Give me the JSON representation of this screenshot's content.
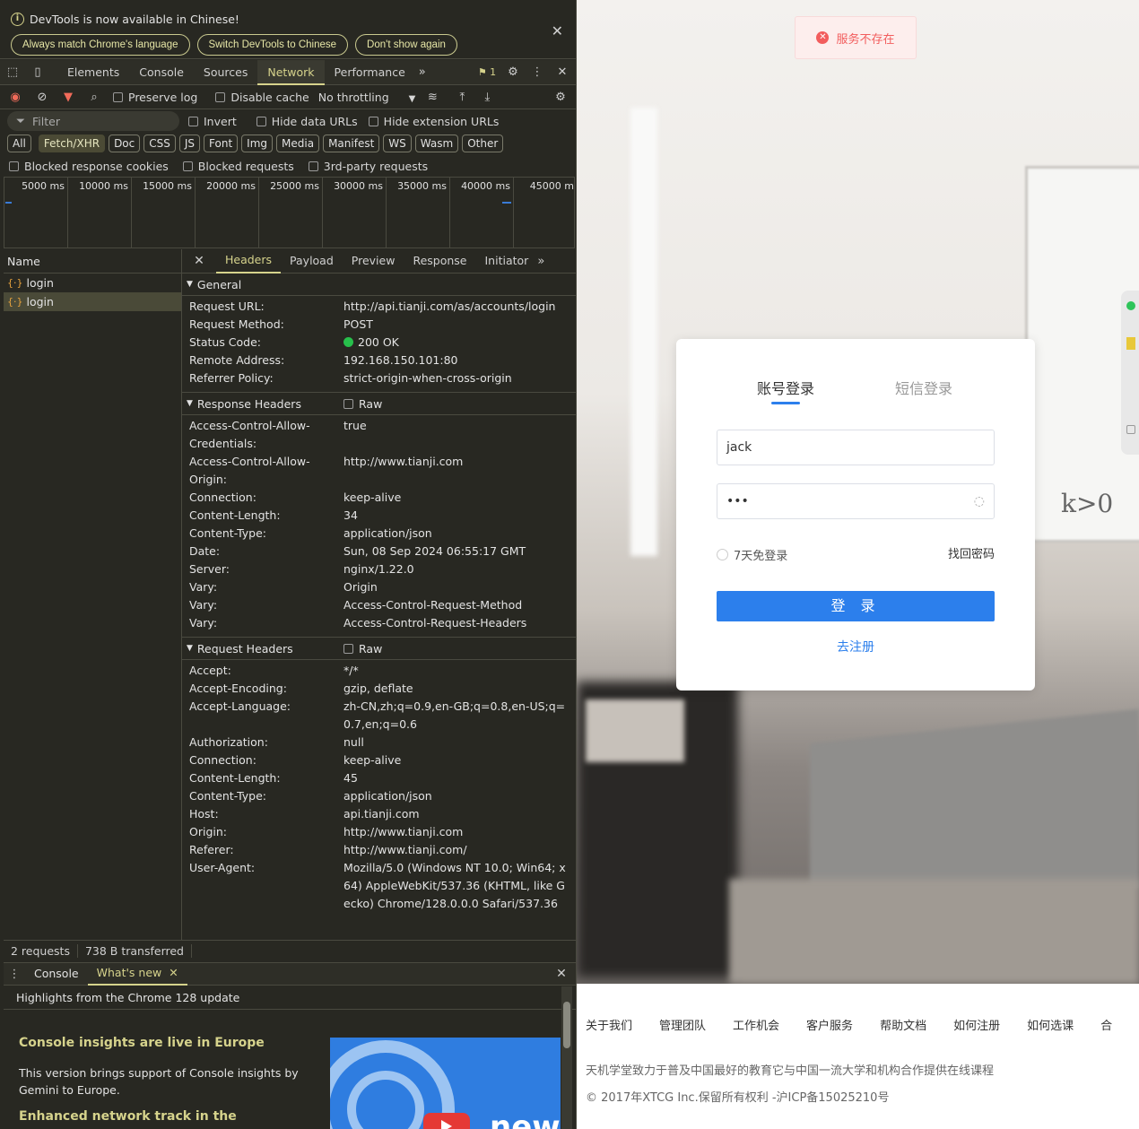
{
  "devtools": {
    "notice": {
      "text": "DevTools is now available in Chinese!",
      "btn1": "Always match Chrome's language",
      "btn2": "Switch DevTools to Chinese",
      "btn3": "Don't show again"
    },
    "tabs": [
      "Elements",
      "Console",
      "Sources",
      "Network",
      "Performance"
    ],
    "active_tab": "Network",
    "issues_count": "1",
    "toolbar": {
      "preserve_log": "Preserve log",
      "disable_cache": "Disable cache",
      "throttling": "No throttling"
    },
    "filter": {
      "placeholder": "Filter",
      "invert": "Invert",
      "hide_data": "Hide data URLs",
      "hide_ext": "Hide extension URLs"
    },
    "types": [
      "All",
      "Fetch/XHR",
      "Doc",
      "CSS",
      "JS",
      "Font",
      "Img",
      "Media",
      "Manifest",
      "WS",
      "Wasm",
      "Other"
    ],
    "blocked": {
      "cookies": "Blocked response cookies",
      "requests": "Blocked requests",
      "third": "3rd-party requests"
    },
    "timeline_ticks": [
      "5000 ms",
      "10000 ms",
      "15000 ms",
      "20000 ms",
      "25000 ms",
      "30000 ms",
      "35000 ms",
      "40000 ms",
      "45000 m"
    ],
    "name_header": "Name",
    "requests": [
      "login",
      "login"
    ],
    "detail_tabs": [
      "Headers",
      "Payload",
      "Preview",
      "Response",
      "Initiator"
    ],
    "general": {
      "title": "General",
      "rows": [
        {
          "k": "Request URL:",
          "v": "http://api.tianji.com/as/accounts/login"
        },
        {
          "k": "Request Method:",
          "v": "POST"
        },
        {
          "k": "Status Code:",
          "v": "200 OK"
        },
        {
          "k": "Remote Address:",
          "v": "192.168.150.101:80"
        },
        {
          "k": "Referrer Policy:",
          "v": "strict-origin-when-cross-origin"
        }
      ]
    },
    "response_headers": {
      "title": "Response Headers",
      "raw": "Raw",
      "rows": [
        {
          "k": "Access-Control-Allow-Credentials:",
          "v": "true"
        },
        {
          "k": "Access-Control-Allow-Origin:",
          "v": "http://www.tianji.com"
        },
        {
          "k": "Connection:",
          "v": "keep-alive"
        },
        {
          "k": "Content-Length:",
          "v": "34"
        },
        {
          "k": "Content-Type:",
          "v": "application/json"
        },
        {
          "k": "Date:",
          "v": "Sun, 08 Sep 2024 06:55:17 GMT"
        },
        {
          "k": "Server:",
          "v": "nginx/1.22.0"
        },
        {
          "k": "Vary:",
          "v": "Origin"
        },
        {
          "k": "Vary:",
          "v": "Access-Control-Request-Method"
        },
        {
          "k": "Vary:",
          "v": "Access-Control-Request-Headers"
        }
      ]
    },
    "request_headers": {
      "title": "Request Headers",
      "raw": "Raw",
      "rows": [
        {
          "k": "Accept:",
          "v": "*/*"
        },
        {
          "k": "Accept-Encoding:",
          "v": "gzip, deflate"
        },
        {
          "k": "Accept-Language:",
          "v": "zh-CN,zh;q=0.9,en-GB;q=0.8,en-US;q=0.7,en;q=0.6"
        },
        {
          "k": "Authorization:",
          "v": "null"
        },
        {
          "k": "Connection:",
          "v": "keep-alive"
        },
        {
          "k": "Content-Length:",
          "v": "45"
        },
        {
          "k": "Content-Type:",
          "v": "application/json"
        },
        {
          "k": "Host:",
          "v": "api.tianji.com"
        },
        {
          "k": "Origin:",
          "v": "http://www.tianji.com"
        },
        {
          "k": "Referer:",
          "v": "http://www.tianji.com/"
        },
        {
          "k": "User-Agent:",
          "v": "Mozilla/5.0 (Windows NT 10.0; Win64; x64) AppleWebKit/537.36 (KHTML, like Gecko) Chrome/128.0.0.0 Safari/537.36"
        }
      ]
    },
    "status": {
      "requests": "2 requests",
      "transferred": "738 B transferred"
    },
    "drawer": {
      "tab_console": "Console",
      "tab_whatsnew": "What's new",
      "heading": "Highlights from the Chrome 128 update",
      "h1": "Console insights are live in Europe",
      "p1": "This version brings support of Console insights by Gemini to Europe.",
      "h2": "Enhanced network track in the",
      "promo_text": "new"
    }
  },
  "page": {
    "toast": "服务不存在",
    "tab_account": "账号登录",
    "tab_sms": "短信登录",
    "username": "jack",
    "password": "•••",
    "remember": "7天免登录",
    "forgot": "找回密码",
    "login": "登 录",
    "register": "去注册",
    "footer_links": [
      "关于我们",
      "管理团队",
      "工作机会",
      "客户服务",
      "帮助文档",
      "如何注册",
      "如何选课",
      "合"
    ],
    "footer_desc": "天机学堂致力于普及中国最好的教育它与中国一流大学和机构合作提供在线课程",
    "footer_copy": "© 2017年XTCG Inc.保留所有权利 -沪ICP备15025210号",
    "accent": "#2c7fec",
    "error_color": "#f25d5d"
  }
}
